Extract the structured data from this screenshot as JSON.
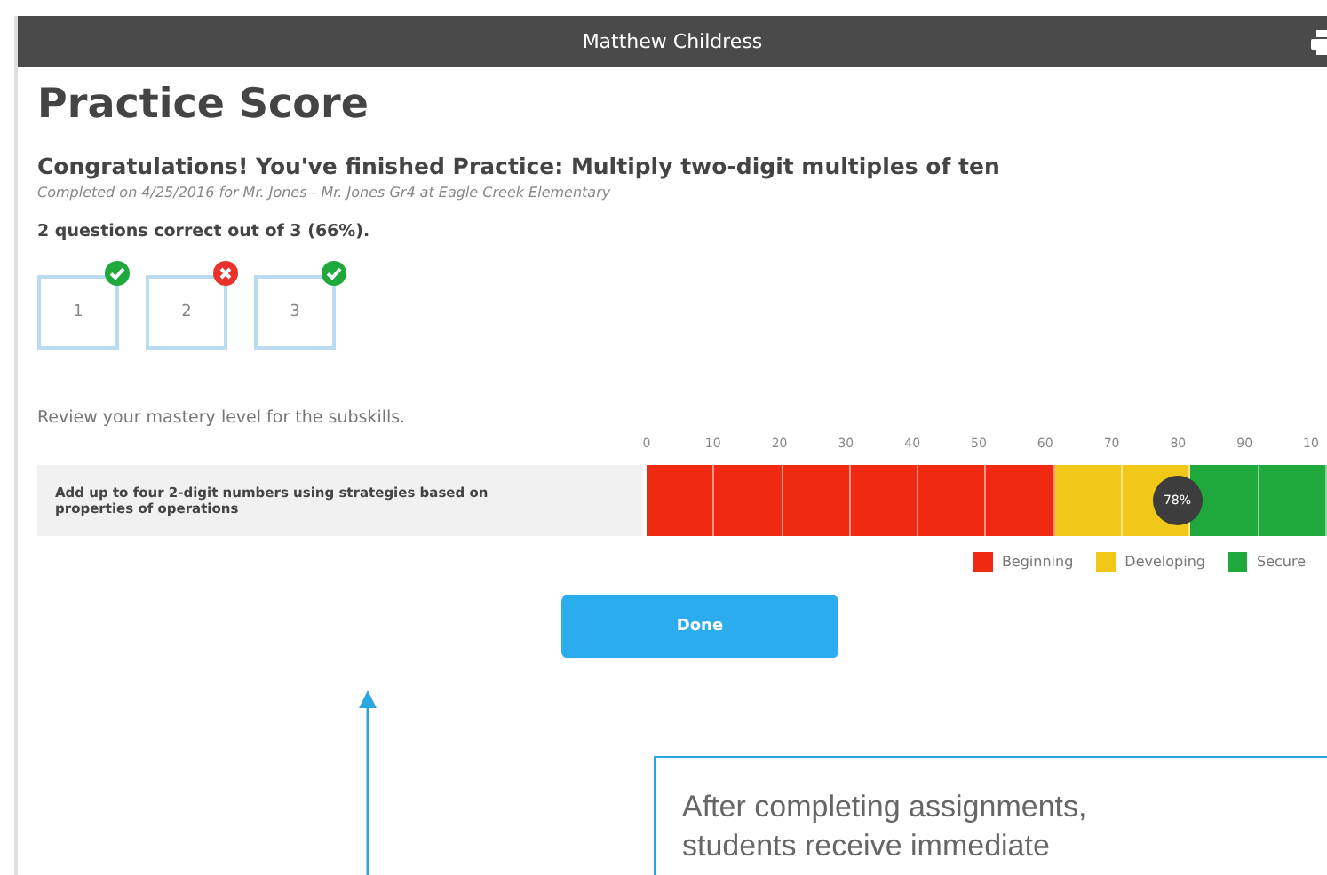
{
  "header": {
    "title": "Matthew Childress"
  },
  "page_title": "Practice Score",
  "heading": "Congratulations! You've finished Practice: Multiply two-digit multiples of ten",
  "completed_note": "Completed on 4/25/2016 for Mr. Jones - Mr. Jones Gr4 at Eagle Creek Elementary",
  "summary": "2 questions correct out of 3 (66%).",
  "questions": [
    {
      "label": "1",
      "correct": true
    },
    {
      "label": "2",
      "correct": false
    },
    {
      "label": "3",
      "correct": true
    }
  ],
  "review_prompt": "Review your mastery level for the subskills.",
  "scale_ticks": [
    "0",
    "10",
    "20",
    "30",
    "40",
    "50",
    "60",
    "70",
    "80",
    "90",
    "10"
  ],
  "subskill": {
    "label": "Add up to four 2-digit numbers using strategies based on properties of operations",
    "segments": [
      {
        "color": "#f02a10"
      },
      {
        "color": "#f02a10"
      },
      {
        "color": "#f02a10"
      },
      {
        "color": "#f02a10"
      },
      {
        "color": "#f02a10"
      },
      {
        "color": "#f02a10"
      },
      {
        "color": "#f2c818"
      },
      {
        "color": "#f2c818"
      },
      {
        "color": "#1fa83c"
      },
      {
        "color": "#1fa83c"
      }
    ],
    "marker": {
      "label": "78%",
      "level": 0.78
    }
  },
  "legend": [
    {
      "label": "Beginning",
      "color": "#f02a10"
    },
    {
      "label": "Developing",
      "color": "#f2c818"
    },
    {
      "label": "Secure",
      "color": "#1fa83c"
    }
  ],
  "done_button": "Done",
  "callout": {
    "lines": [
      "After completing assignments,",
      "students receive immediate"
    ]
  }
}
